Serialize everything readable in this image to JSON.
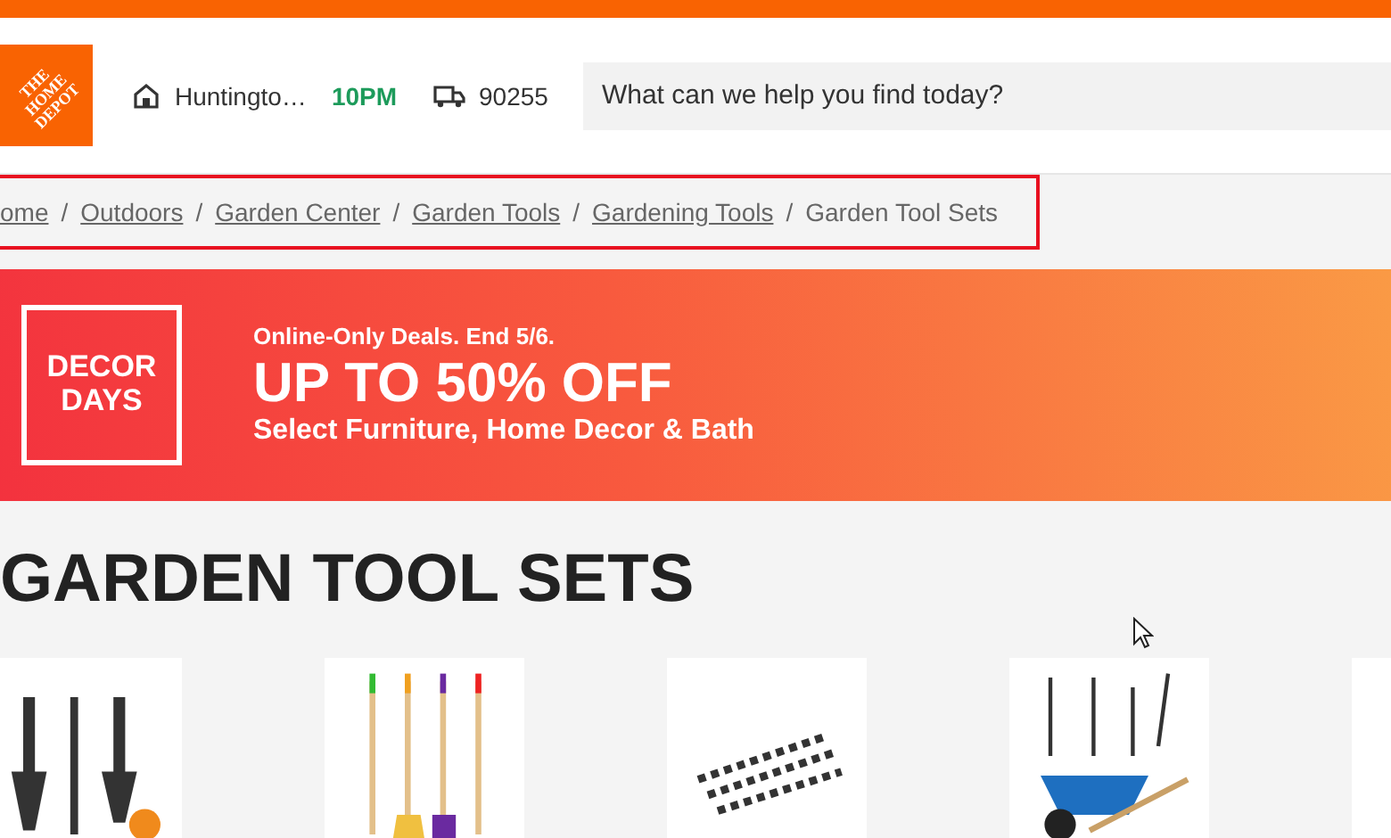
{
  "header": {
    "logo_text": "THE HOME DEPOT",
    "store": "Huntingto…",
    "store_hours": "10PM",
    "zip": "90255",
    "search": {
      "placeholder": "What can we help you find today?"
    }
  },
  "breadcrumb_separator": "/",
  "breadcrumb": [
    {
      "label": "ome",
      "link": true
    },
    {
      "label": "Outdoors",
      "link": true
    },
    {
      "label": "Garden Center",
      "link": true
    },
    {
      "label": "Garden Tools",
      "link": true
    },
    {
      "label": "Gardening Tools",
      "link": true
    },
    {
      "label": "Garden Tool Sets",
      "link": false
    }
  ],
  "banner": {
    "badge_lines": [
      "DECOR",
      "DAYS"
    ],
    "eyebrow": "Online-Only Deals. End 5/6.",
    "headline": "UP TO 50% OFF",
    "subline": "Select Furniture, Home Decor & Bath"
  },
  "page_title": "GARDEN TOOL SETS",
  "products": [
    {
      "kind": "hand-tools"
    },
    {
      "kind": "kids-tools"
    },
    {
      "kind": "parts"
    },
    {
      "kind": "wheelbarrow"
    },
    {
      "kind": "cut"
    }
  ]
}
